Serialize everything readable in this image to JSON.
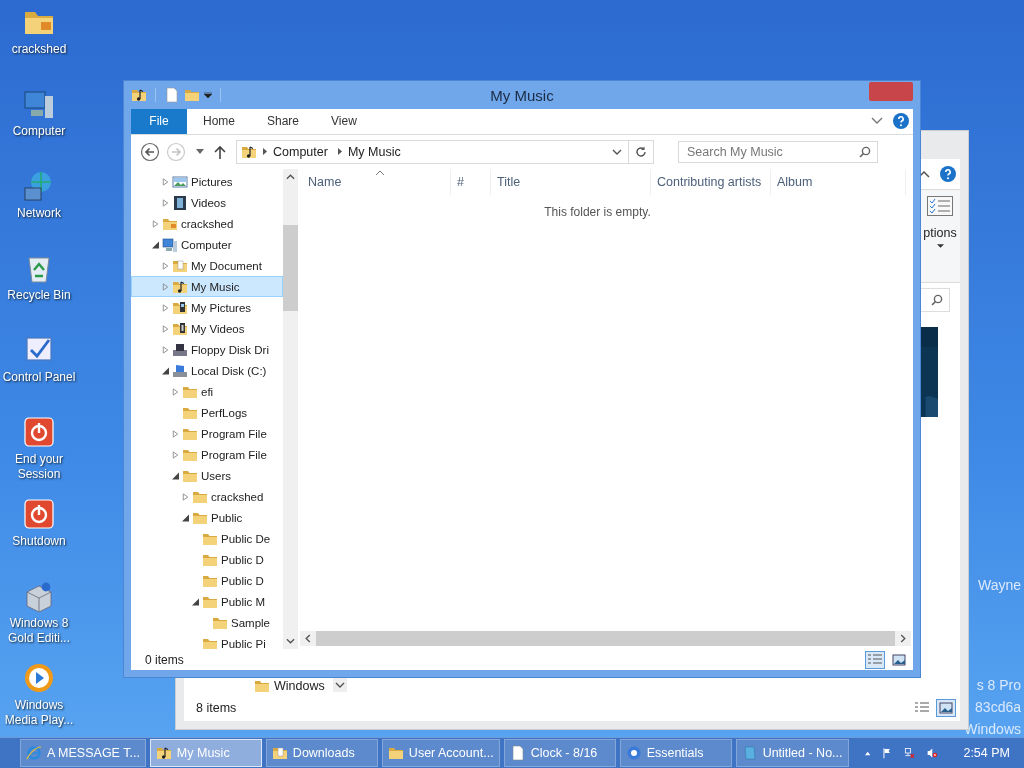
{
  "desktop_icons": [
    {
      "label": "crackshed"
    },
    {
      "label": "Computer"
    },
    {
      "label": "Network"
    },
    {
      "label": "Recycle Bin"
    },
    {
      "label": "Control Panel"
    },
    {
      "label": "End your Session"
    },
    {
      "label": "Shutdown"
    },
    {
      "label": "Windows 8 Gold Editi..."
    },
    {
      "label": "Windows Media Play..."
    }
  ],
  "desktop_text": [
    "Wayne",
    "s 8 Pro",
    "83cd6a",
    "Windows"
  ],
  "back_window": {
    "ribbon_group_label": "ptions",
    "tree_item": "Windows",
    "status": "8 items",
    "views": [
      {
        "kind": "details",
        "selected": false
      },
      {
        "kind": "large-icons",
        "selected": true
      }
    ]
  },
  "window": {
    "title": "My Music",
    "ribbon_tabs": [
      {
        "label": "File",
        "kind": "file"
      },
      {
        "label": "Home",
        "kind": "tab"
      },
      {
        "label": "Share",
        "kind": "tab"
      },
      {
        "label": "View",
        "kind": "tab"
      }
    ],
    "back": {
      "disabled": false
    },
    "forward": {
      "disabled": true
    },
    "address": {
      "path": [
        "Computer",
        "My Music"
      ]
    },
    "search": {
      "placeholder": "Search My Music"
    },
    "tree": [
      {
        "children": [
          {
            "label": "Pictures",
            "kind": "pictures",
            "expanded": false,
            "selected": false
          },
          {
            "label": "Videos",
            "kind": "videos",
            "expanded": false,
            "selected": false
          }
        ]
      },
      {
        "label": "crackshed",
        "kind": "user",
        "expanded": false,
        "selected": false
      },
      {
        "label": "Computer",
        "kind": "computer",
        "expanded": true,
        "selected": false,
        "children": [
          {
            "label": "My Document",
            "kind": "documents",
            "expanded": false,
            "selected": false
          },
          {
            "label": "My Music",
            "kind": "music",
            "expanded": false,
            "selected": true
          },
          {
            "label": "My Pictures",
            "kind": "photos",
            "expanded": false,
            "selected": false
          },
          {
            "label": "My Videos",
            "kind": "movies",
            "expanded": false,
            "selected": false
          },
          {
            "label": "Floppy Disk Dri",
            "kind": "floppy",
            "expanded": false,
            "selected": false
          },
          {
            "label": "Local Disk (C:)",
            "kind": "disk",
            "expanded": true,
            "selected": false,
            "children": [
              {
                "label": "efi",
                "kind": "folder",
                "expanded": false,
                "selected": false
              },
              {
                "label": "PerfLogs",
                "kind": "folder",
                "selected": false
              },
              {
                "label": "Program File",
                "kind": "folder",
                "expanded": false,
                "selected": false
              },
              {
                "label": "Program File",
                "kind": "folder",
                "expanded": false,
                "selected": false
              },
              {
                "label": "Users",
                "kind": "folder",
                "expanded": true,
                "selected": false,
                "children": [
                  {
                    "label": "crackshed",
                    "kind": "folder",
                    "expanded": false,
                    "selected": false
                  },
                  {
                    "label": "Public",
                    "kind": "folder",
                    "expanded": true,
                    "selected": false,
                    "children": [
                      {
                        "label": "Public De",
                        "kind": "folder",
                        "selected": false
                      },
                      {
                        "label": "Public D",
                        "kind": "folder",
                        "selected": false
                      },
                      {
                        "label": "Public D",
                        "kind": "folder",
                        "selected": false
                      },
                      {
                        "label": "Public M",
                        "kind": "folder",
                        "expanded": true,
                        "selected": false,
                        "children": [
                          {
                            "label": "Sample",
                            "kind": "folder",
                            "selected": false
                          }
                        ]
                      },
                      {
                        "label": "Public Pi",
                        "kind": "folder",
                        "selected": false
                      }
                    ]
                  }
                ]
              }
            ]
          }
        ]
      }
    ],
    "columns": [
      {
        "label": "Name",
        "sorted": true
      },
      {
        "label": "#",
        "sorted": false
      },
      {
        "label": "Title",
        "sorted": false
      },
      {
        "label": "Contributing artists",
        "sorted": false
      },
      {
        "label": "Album",
        "sorted": false
      }
    ],
    "empty_message": "This folder is empty.",
    "status": "0 items",
    "views": [
      {
        "kind": "details",
        "selected": true
      },
      {
        "kind": "large-icons",
        "selected": false
      }
    ]
  },
  "taskbar": {
    "items": [
      {
        "label": "A MESSAGE T...",
        "selected": false
      },
      {
        "label": "My Music",
        "selected": true
      },
      {
        "label": "Downloads",
        "selected": false
      },
      {
        "label": "User Account...",
        "selected": false
      },
      {
        "label": "Clock - 8/16",
        "selected": false
      },
      {
        "label": "Essentials",
        "selected": false
      },
      {
        "label": "Untitled - No...",
        "selected": false
      }
    ],
    "clock": "2:54 PM"
  }
}
